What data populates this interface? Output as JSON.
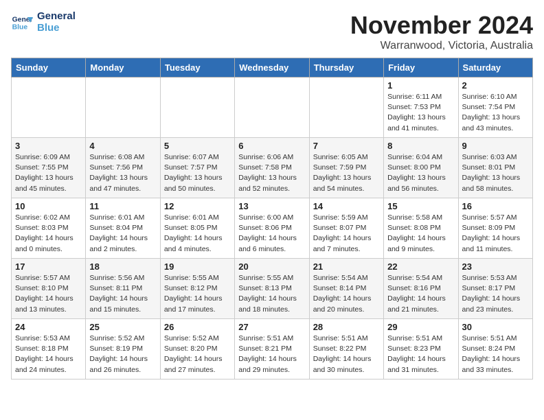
{
  "logo": {
    "line1": "General",
    "line2": "Blue"
  },
  "header": {
    "month": "November 2024",
    "location": "Warranwood, Victoria, Australia"
  },
  "weekdays": [
    "Sunday",
    "Monday",
    "Tuesday",
    "Wednesday",
    "Thursday",
    "Friday",
    "Saturday"
  ],
  "weeks": [
    [
      {
        "day": "",
        "info": ""
      },
      {
        "day": "",
        "info": ""
      },
      {
        "day": "",
        "info": ""
      },
      {
        "day": "",
        "info": ""
      },
      {
        "day": "",
        "info": ""
      },
      {
        "day": "1",
        "info": "Sunrise: 6:11 AM\nSunset: 7:53 PM\nDaylight: 13 hours\nand 41 minutes."
      },
      {
        "day": "2",
        "info": "Sunrise: 6:10 AM\nSunset: 7:54 PM\nDaylight: 13 hours\nand 43 minutes."
      }
    ],
    [
      {
        "day": "3",
        "info": "Sunrise: 6:09 AM\nSunset: 7:55 PM\nDaylight: 13 hours\nand 45 minutes."
      },
      {
        "day": "4",
        "info": "Sunrise: 6:08 AM\nSunset: 7:56 PM\nDaylight: 13 hours\nand 47 minutes."
      },
      {
        "day": "5",
        "info": "Sunrise: 6:07 AM\nSunset: 7:57 PM\nDaylight: 13 hours\nand 50 minutes."
      },
      {
        "day": "6",
        "info": "Sunrise: 6:06 AM\nSunset: 7:58 PM\nDaylight: 13 hours\nand 52 minutes."
      },
      {
        "day": "7",
        "info": "Sunrise: 6:05 AM\nSunset: 7:59 PM\nDaylight: 13 hours\nand 54 minutes."
      },
      {
        "day": "8",
        "info": "Sunrise: 6:04 AM\nSunset: 8:00 PM\nDaylight: 13 hours\nand 56 minutes."
      },
      {
        "day": "9",
        "info": "Sunrise: 6:03 AM\nSunset: 8:01 PM\nDaylight: 13 hours\nand 58 minutes."
      }
    ],
    [
      {
        "day": "10",
        "info": "Sunrise: 6:02 AM\nSunset: 8:03 PM\nDaylight: 14 hours\nand 0 minutes."
      },
      {
        "day": "11",
        "info": "Sunrise: 6:01 AM\nSunset: 8:04 PM\nDaylight: 14 hours\nand 2 minutes."
      },
      {
        "day": "12",
        "info": "Sunrise: 6:01 AM\nSunset: 8:05 PM\nDaylight: 14 hours\nand 4 minutes."
      },
      {
        "day": "13",
        "info": "Sunrise: 6:00 AM\nSunset: 8:06 PM\nDaylight: 14 hours\nand 6 minutes."
      },
      {
        "day": "14",
        "info": "Sunrise: 5:59 AM\nSunset: 8:07 PM\nDaylight: 14 hours\nand 7 minutes."
      },
      {
        "day": "15",
        "info": "Sunrise: 5:58 AM\nSunset: 8:08 PM\nDaylight: 14 hours\nand 9 minutes."
      },
      {
        "day": "16",
        "info": "Sunrise: 5:57 AM\nSunset: 8:09 PM\nDaylight: 14 hours\nand 11 minutes."
      }
    ],
    [
      {
        "day": "17",
        "info": "Sunrise: 5:57 AM\nSunset: 8:10 PM\nDaylight: 14 hours\nand 13 minutes."
      },
      {
        "day": "18",
        "info": "Sunrise: 5:56 AM\nSunset: 8:11 PM\nDaylight: 14 hours\nand 15 minutes."
      },
      {
        "day": "19",
        "info": "Sunrise: 5:55 AM\nSunset: 8:12 PM\nDaylight: 14 hours\nand 17 minutes."
      },
      {
        "day": "20",
        "info": "Sunrise: 5:55 AM\nSunset: 8:13 PM\nDaylight: 14 hours\nand 18 minutes."
      },
      {
        "day": "21",
        "info": "Sunrise: 5:54 AM\nSunset: 8:14 PM\nDaylight: 14 hours\nand 20 minutes."
      },
      {
        "day": "22",
        "info": "Sunrise: 5:54 AM\nSunset: 8:16 PM\nDaylight: 14 hours\nand 21 minutes."
      },
      {
        "day": "23",
        "info": "Sunrise: 5:53 AM\nSunset: 8:17 PM\nDaylight: 14 hours\nand 23 minutes."
      }
    ],
    [
      {
        "day": "24",
        "info": "Sunrise: 5:53 AM\nSunset: 8:18 PM\nDaylight: 14 hours\nand 24 minutes."
      },
      {
        "day": "25",
        "info": "Sunrise: 5:52 AM\nSunset: 8:19 PM\nDaylight: 14 hours\nand 26 minutes."
      },
      {
        "day": "26",
        "info": "Sunrise: 5:52 AM\nSunset: 8:20 PM\nDaylight: 14 hours\nand 27 minutes."
      },
      {
        "day": "27",
        "info": "Sunrise: 5:51 AM\nSunset: 8:21 PM\nDaylight: 14 hours\nand 29 minutes."
      },
      {
        "day": "28",
        "info": "Sunrise: 5:51 AM\nSunset: 8:22 PM\nDaylight: 14 hours\nand 30 minutes."
      },
      {
        "day": "29",
        "info": "Sunrise: 5:51 AM\nSunset: 8:23 PM\nDaylight: 14 hours\nand 31 minutes."
      },
      {
        "day": "30",
        "info": "Sunrise: 5:51 AM\nSunset: 8:24 PM\nDaylight: 14 hours\nand 33 minutes."
      }
    ]
  ]
}
